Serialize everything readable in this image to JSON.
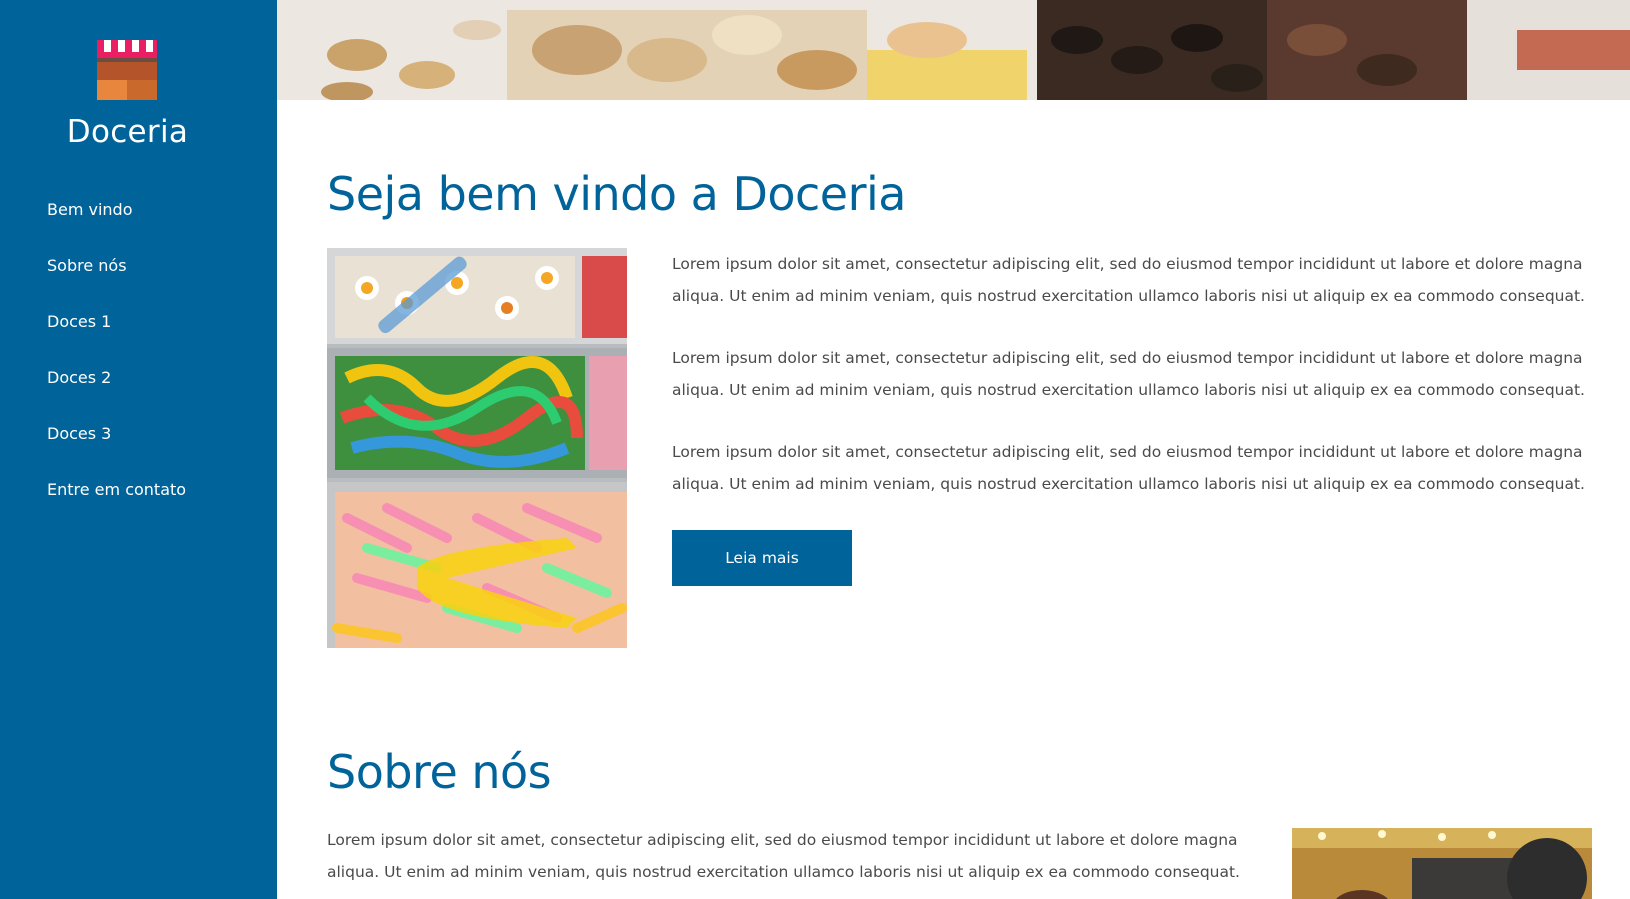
{
  "brand": {
    "name": "Doceria",
    "logo_icon": "market-stall-icon"
  },
  "nav": {
    "items": [
      {
        "label": "Bem vindo"
      },
      {
        "label": "Sobre nós"
      },
      {
        "label": "Doces 1"
      },
      {
        "label": "Doces 2"
      },
      {
        "label": "Doces 3"
      },
      {
        "label": "Entre em contato"
      }
    ]
  },
  "welcome": {
    "title": "Seja bem vindo a Doceria",
    "paragraphs": [
      "Lorem ipsum dolor sit amet, consectetur adipiscing elit, sed do eiusmod tempor incididunt ut labore et dolore magna aliqua. Ut enim ad minim veniam, quis nostrud exercitation ullamco laboris nisi ut aliquip ex ea commodo consequat.",
      "Lorem ipsum dolor sit amet, consectetur adipiscing elit, sed do eiusmod tempor incididunt ut labore et dolore magna aliqua. Ut enim ad minim veniam, quis nostrud exercitation ullamco laboris nisi ut aliquip ex ea commodo consequat.",
      "Lorem ipsum dolor sit amet, consectetur adipiscing elit, sed do eiusmod tempor incididunt ut labore et dolore magna aliqua. Ut enim ad minim veniam, quis nostrud exercitation ullamco laboris nisi ut aliquip ex ea commodo consequat."
    ],
    "button_label": "Leia mais"
  },
  "about": {
    "title": "Sobre nós",
    "paragraph": "Lorem ipsum dolor sit amet, consectetur adipiscing elit, sed do eiusmod tempor incididunt ut labore et dolore magna aliqua. Ut enim ad minim veniam, quis nostrud exercitation ullamco laboris nisi ut aliquip ex ea commodo consequat."
  },
  "colors": {
    "primary": "#00639a",
    "text": "#4a4a4a",
    "background": "#ffffff"
  }
}
